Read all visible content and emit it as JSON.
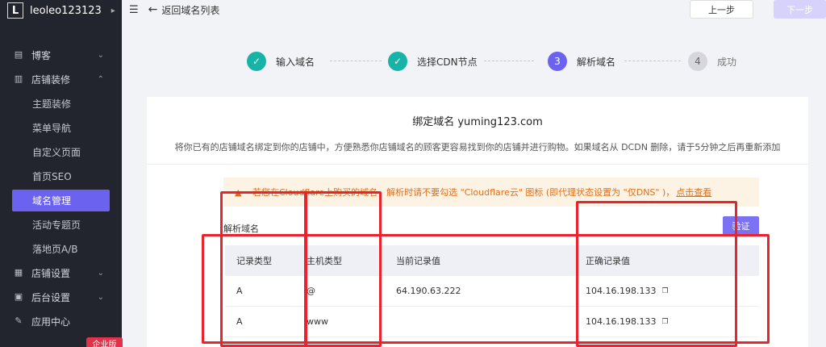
{
  "store": {
    "logo": "L",
    "name": "leoleo123123",
    "caret": "▸"
  },
  "sidebar": {
    "items": [
      {
        "label": "博客",
        "icon": "blog-icon",
        "chev": "⌄"
      },
      {
        "label": "店铺装修",
        "icon": "paint-roller-icon",
        "chev": "⌃"
      }
    ],
    "sub": [
      "主题装修",
      "菜单导航",
      "自定义页面",
      "首页SEO",
      "域名管理",
      "活动专题页",
      "落地页A/B"
    ],
    "items2": [
      {
        "label": "店铺设置",
        "icon": "store-settings-icon",
        "chev": "⌄"
      },
      {
        "label": "后台设置",
        "icon": "admin-settings-icon",
        "chev": "⌄"
      },
      {
        "label": "应用中心",
        "icon": "wrench-icon"
      }
    ],
    "enterprise_badge": "企业版"
  },
  "topbar": {
    "back_label": "返回域名列表",
    "prev_label": "上一步",
    "next_label": "下一步"
  },
  "steps": [
    {
      "num": "✓",
      "label": "输入域名",
      "state": "done"
    },
    {
      "num": "✓",
      "label": "选择CDN节点",
      "state": "done"
    },
    {
      "num": "3",
      "label": "解析域名",
      "state": "current"
    },
    {
      "num": "4",
      "label": "成功",
      "state": "todo"
    }
  ],
  "card": {
    "title": "绑定域名 yuming123.com",
    "desc": "将你已有的店铺域名绑定到你的店铺中，方便熟悉你店铺域名的顾客更容易找到你的店铺并进行购物。如果域名从 DCDN 删除，请于5分钟之后再重新添加",
    "warning": "若您在Cloudflare上购买的域名，解析时请不要勾选 \"Cloudflare云\" 图标 (即代理状态设置为 \"仅DNS\" )，",
    "warning_link": "点击查看",
    "section_label": "解析域名",
    "verify_label": "验证"
  },
  "table": {
    "headers": [
      "记录类型",
      "主机类型",
      "当前记录值",
      "正确记录值"
    ],
    "rows": [
      [
        "A",
        "@",
        "64.190.63.222",
        "104.16.198.133"
      ],
      [
        "A",
        "www",
        "",
        "104.16.198.133"
      ]
    ]
  },
  "colors": {
    "accent": "#6b62f0",
    "done": "#16b3a6",
    "warning": "#e0701a",
    "annotation": "#e8242e"
  }
}
